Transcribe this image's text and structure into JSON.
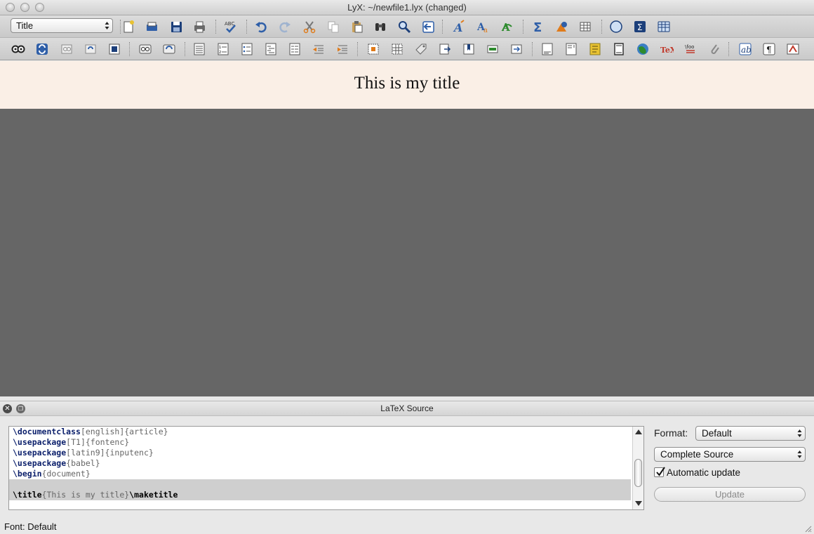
{
  "window": {
    "title": "LyX: ~/newfile1.lyx (changed)"
  },
  "toolbar": {
    "layout_select": "Title",
    "icons_row1": [
      "new-document-icon",
      "open-icon",
      "save-icon",
      "print-icon",
      "spellcheck-icon",
      "undo-icon",
      "redo-icon",
      "cut-icon",
      "copy-icon",
      "paste-icon",
      "find-icon",
      "find-replace-icon",
      "back-icon",
      "text-style-icon",
      "font-icon",
      "change-tracking-icon",
      "math-sum-icon",
      "insert-graphics-icon",
      "insert-table-icon",
      "navigate-icon",
      "math-panel-icon",
      "table-panel-icon"
    ],
    "icons_row2": [
      "view-icon",
      "update-icon",
      "view-dvi-icon",
      "update-dvi-icon",
      "view-pdf-icon",
      "view-master-icon",
      "update-master-icon",
      "standard-paragraph-icon",
      "enumerate-icon",
      "itemize-icon",
      "description-icon",
      "list-icon",
      "decrease-depth-icon",
      "increase-depth-icon",
      "insert-figure-icon",
      "insert-table-float-icon",
      "label-icon",
      "cross-ref-icon",
      "citation-icon",
      "index-icon",
      "nomenclature-icon",
      "footnote-icon",
      "margin-note-icon",
      "note-icon",
      "box-icon",
      "url-icon",
      "tex-code-icon",
      "foo-icon",
      "attachment-icon",
      "emphasis-icon",
      "paragraph-icon",
      "pdf-icon"
    ],
    "tex_label": "TeX",
    "foo_label": "\\foo",
    "abc_label": "ABC"
  },
  "document": {
    "title": "This is my title"
  },
  "source_panel": {
    "header": "LaTeX Source",
    "lines": [
      {
        "cmd": "\\documentclass",
        "args": "[english]{article}"
      },
      {
        "cmd": "\\usepackage",
        "args": "[T1]{fontenc}"
      },
      {
        "cmd": "\\usepackage",
        "args": "[latin9]{inputenc}"
      },
      {
        "cmd": "\\usepackage",
        "args": "{babel}"
      },
      {
        "cmd": "\\begin",
        "args": "{document}"
      }
    ],
    "title_line": {
      "cmd": "\\title",
      "args": "{This is my title}",
      "cmd2": "\\maketitle"
    },
    "format_label": "Format:",
    "format_value": "Default",
    "source_mode_value": "Complete Source",
    "auto_update_label": "Automatic update",
    "auto_update_checked": true,
    "update_button": "Update"
  },
  "status": {
    "text": "Font: Default"
  },
  "colors": {
    "title_band": "#faefe6",
    "doc_background": "#666666",
    "latex_command": "#0b1f6b",
    "icon_blue": "#2f5fa8"
  }
}
